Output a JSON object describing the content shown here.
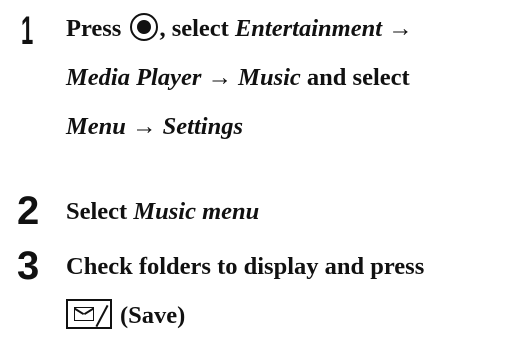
{
  "steps": [
    {
      "number": "1",
      "lines": [
        [
          "Press ",
          "",
          ", select ",
          "Entertainment",
          " →"
        ],
        [
          "Media Player",
          " → ",
          "Music",
          " and select"
        ],
        [
          "Menu",
          " → ",
          "Settings"
        ]
      ]
    },
    {
      "number": "2",
      "prefix": "Select ",
      "item": "Music menu"
    },
    {
      "number": "3",
      "line1": "Check folders to display and press",
      "save_label": "(Save)"
    }
  ],
  "icons": {
    "center_key": "center-select-key-icon",
    "mail_key": "mail-save-key-icon"
  }
}
